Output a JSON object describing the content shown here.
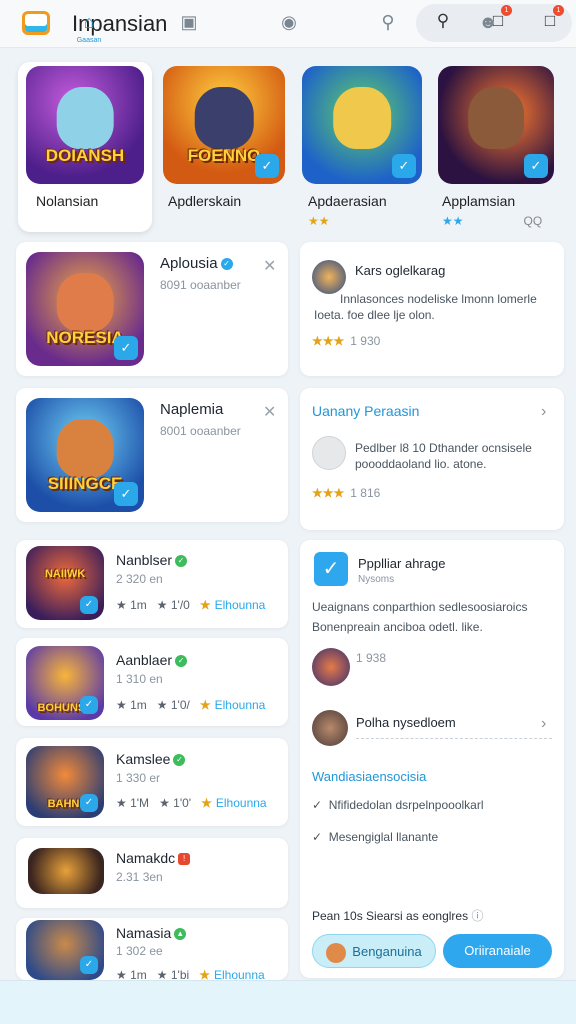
{
  "header": {
    "title": "Inpansian",
    "notif_badge": "1",
    "msg_badge": "1"
  },
  "top_tiles": [
    {
      "art_title": "DOIANSH",
      "name": "Nolansian",
      "rating": ""
    },
    {
      "art_title": "FOENNO",
      "name": "Apdlerskain",
      "rating": ""
    },
    {
      "art_title": "",
      "name": "Apdaerasian",
      "rating": "★★"
    },
    {
      "art_title": "",
      "name": "Applamsian",
      "rating": "★★",
      "rating_count": "QQ"
    }
  ],
  "cards_left_big": [
    {
      "art_title": "NORESIA",
      "title": "Aplousia",
      "sub": "8091 ooaanber"
    },
    {
      "art_title": "SIIINGCE",
      "title": "Naplemia",
      "sub": "8001 ooaanber"
    }
  ],
  "cards_right": [
    {
      "title": "Kars oglelkarag",
      "body_1": "Innlasonces nodeliske lmonn lomerle",
      "body_2": "Ioeta. foe dlee lje olon.",
      "stars": "★★★",
      "count": "1 930"
    },
    {
      "title": "Uanany Peraasin",
      "body_1": "Pedlber l8 10 Dthander ocnsisele",
      "body_2": "poooddaoland lio. atone.",
      "stars": "★★★",
      "count": "1 816"
    }
  ],
  "list": [
    {
      "art_title": "NAIIWK",
      "title": "Nanblser",
      "sub": "2 320 en",
      "rating": "★ 1m",
      "rating2": "★ 1'/0",
      "badge": "Elhounna"
    },
    {
      "art_title": "BOHUNSE",
      "title": "Aanblaer",
      "sub": "1 310 en",
      "rating": "★ 1m",
      "rating2": "★ 1'0/",
      "badge": "Elhounna"
    },
    {
      "art_title": "BAHNI",
      "title": "Kamslee",
      "sub": "1 330 er",
      "rating": "★ 1'M",
      "rating2": "★ 1'0'",
      "badge": "Elhounna"
    },
    {
      "art_title": "",
      "title": "Namakdc",
      "sub": "2.31 3en",
      "rating": "",
      "rating2": "",
      "badge": ""
    },
    {
      "art_title": "",
      "title": "Namasia",
      "sub": "1 302 ee",
      "rating": "★ 1m",
      "rating2": "★ 1'bi",
      "badge": "Elhounna"
    }
  ],
  "side_panel": {
    "title": "Ppplliar ahrage",
    "sub": "Nysoms",
    "body_1": "Ueaignans conparthion sedlesoosiaroics",
    "body_2": "Bonenpreain anciboa odetl. like.",
    "count": "1 938",
    "row_title": "Polha nysedloem",
    "section": "Wandiasiaensocisia",
    "check_1": "Nfifidedolan dsrpelnpooolkarl",
    "check_2": "Mesengiglal llanante",
    "footer": "Pean 10s Siearsi as eonglres",
    "btn_left": "Benganuina",
    "btn_right": "Oriiranaiale"
  },
  "tabbar": {
    "home_label": "Gaasan"
  },
  "colors": {
    "accent": "#2ea7ee",
    "star": "#e3a318",
    "badge": "#ef4b2f"
  }
}
